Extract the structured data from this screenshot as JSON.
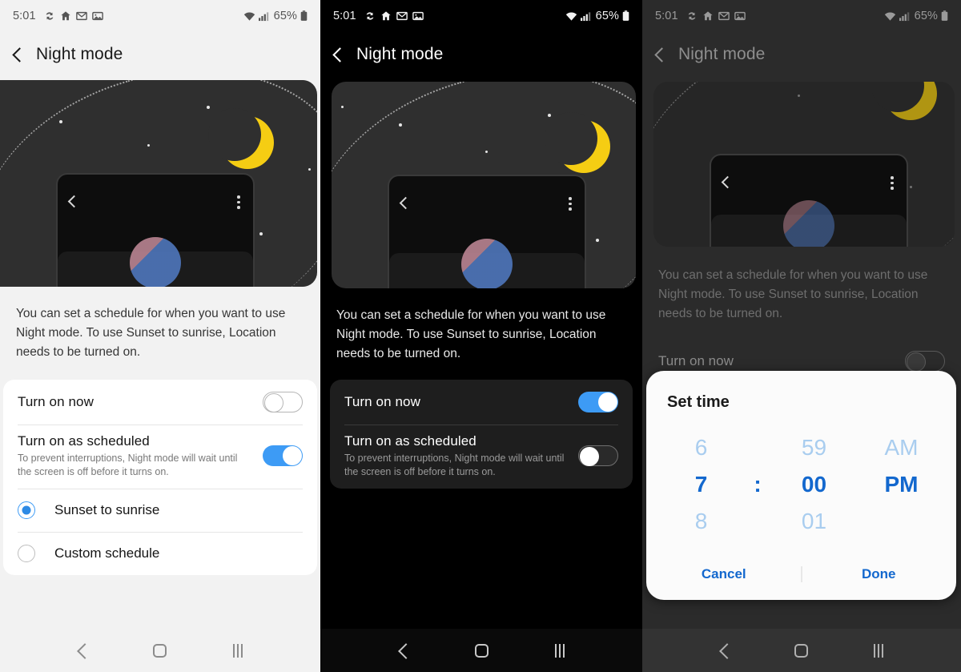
{
  "status_bar": {
    "time": "5:01",
    "icons": [
      "sync-icon",
      "home-icon",
      "gmail-icon",
      "photos-icon"
    ],
    "wifi_icon": "wifi-icon",
    "signal_icon": "cellular-signal-icon",
    "battery_percent": "65%",
    "battery_icon": "battery-icon"
  },
  "app_bar": {
    "back_icon": "back-chevron-icon",
    "title": "Night mode"
  },
  "hero": {
    "moon_icon": "crescent-moon-icon",
    "moon_color": "#f5cd13",
    "arc_icon": "dotted-arc-icon",
    "inner_back_icon": "back-chevron-icon",
    "inner_overflow_icon": "more-vertical-icon"
  },
  "description": "You can set a schedule for when you want to use Night mode. To use Sunset to sunrise, Location needs to be turned on.",
  "rows": {
    "turn_on_now": {
      "title": "Turn on now",
      "state_panel1": "off",
      "state_panel2": "on",
      "state_panel3": "off"
    },
    "turn_on_scheduled": {
      "title": "Turn on as scheduled",
      "subtitle": "To prevent interruptions, Night mode will wait until the screen is off before it turns on.",
      "state_panel1": "on",
      "state_panel2": "off"
    }
  },
  "schedule_options": [
    {
      "label": "Sunset to sunrise",
      "selected": true
    },
    {
      "label": "Custom schedule",
      "selected": false
    }
  ],
  "dialog": {
    "title": "Set time",
    "hours": {
      "prev": "6",
      "selected": "7",
      "next": "8"
    },
    "separator": ":",
    "minutes": {
      "prev": "59",
      "selected": "00",
      "next": "01"
    },
    "meridiem": {
      "prev": "AM",
      "selected": "PM"
    },
    "cancel_label": "Cancel",
    "done_label": "Done",
    "accent_color": "#1368ce"
  },
  "nav_bar": {
    "back_icon": "nav-back-icon",
    "home_icon": "nav-home-icon",
    "recents_icon": "nav-recents-icon"
  },
  "accents": {
    "toggle_on": "#3d9bf5",
    "radio_on": "#2d8ae5",
    "light_bg": "#f2f2f2",
    "dark_bg": "#000000"
  }
}
